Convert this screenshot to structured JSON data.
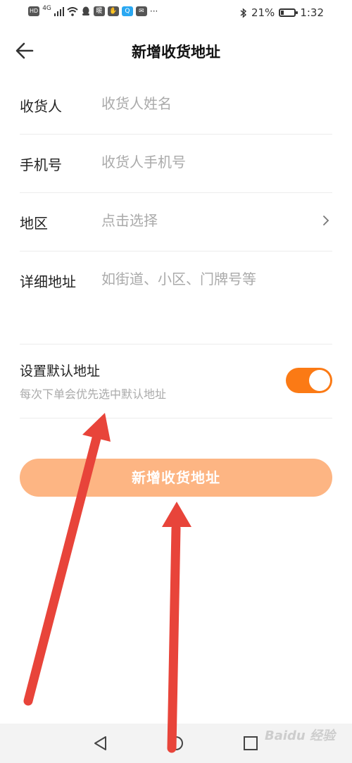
{
  "status_bar": {
    "left_icons": [
      "HD",
      "4G",
      "signal-icon",
      "wifi-icon",
      "qq-icon",
      "app-icon",
      "app-icon",
      "search-app-icon",
      "mail-icon",
      "more-icon"
    ],
    "hd": "HD",
    "net": "4G",
    "battery_percent_text": "21%",
    "battery_level": 0.21,
    "time": "1:32"
  },
  "nav": {
    "title": "新增收货地址"
  },
  "form": {
    "recipient_label": "收货人",
    "recipient_placeholder": "收货人姓名",
    "phone_label": "手机号",
    "phone_placeholder": "收货人手机号",
    "region_label": "地区",
    "region_placeholder": "点击选择",
    "detail_label": "详细地址",
    "detail_placeholder": "如街道、小区、门牌号等"
  },
  "default_address": {
    "title": "设置默认地址",
    "subtitle": "每次下单会优先选中默认地址",
    "enabled": true
  },
  "submit": {
    "label": "新增收货地址"
  },
  "watermark": "Baidu 经验",
  "colors": {
    "accent": "#fb7a15",
    "button_bg": "#fdb583",
    "annotation_arrow": "#e8443a"
  }
}
